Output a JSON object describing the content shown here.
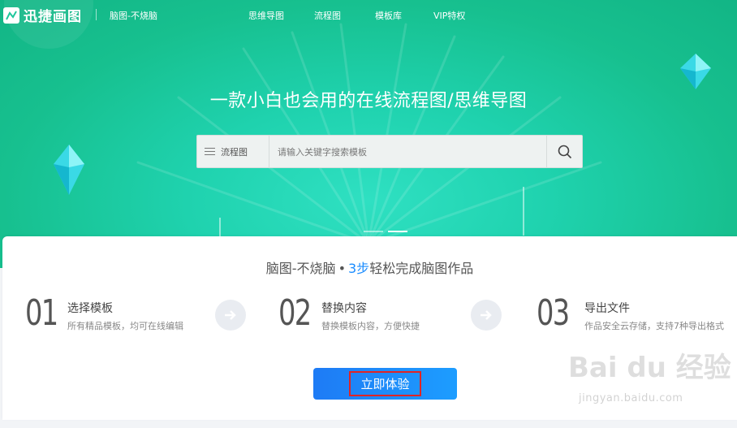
{
  "header": {
    "logo_text": "迅捷画图",
    "slogan": "脑图-不烧脑",
    "nav": [
      "思维导图",
      "流程图",
      "模板库",
      "VIP特权"
    ]
  },
  "hero": {
    "headline": "一款小白也会用的在线流程图/思维导图",
    "search": {
      "category": "流程图",
      "placeholder": "请输入关键字搜索模板"
    }
  },
  "steps_section": {
    "title_prefix": "脑图-不烧脑",
    "title_dot": "•",
    "title_highlight": "3步",
    "title_suffix": "轻松完成脑图作品",
    "steps": [
      {
        "num": "01",
        "title": "选择模板",
        "desc": "所有精品模板，均可在线编辑"
      },
      {
        "num": "02",
        "title": "替换内容",
        "desc": "替换模板内容，方便快捷"
      },
      {
        "num": "03",
        "title": "导出文件",
        "desc": "作品安全云存储，支持7种导出格式"
      }
    ],
    "cta_label": "立即体验"
  },
  "watermark": {
    "line1": "Bai du 经验",
    "line2": "jingyan.baidu.com"
  },
  "colors": {
    "hero_green": "#1fd2ae",
    "accent_blue": "#1a8cff",
    "button_blue": "#1e7bf5",
    "highlight_red": "#e12424"
  }
}
